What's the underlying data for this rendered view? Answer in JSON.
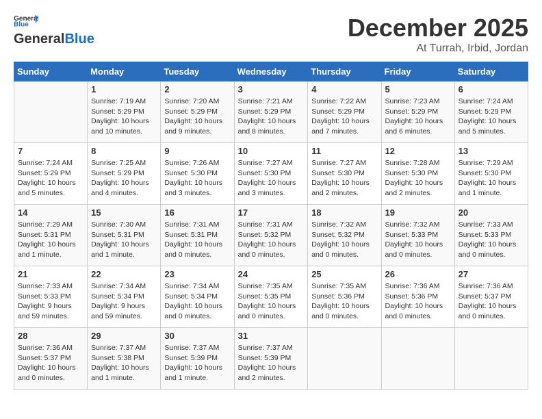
{
  "header": {
    "logo_general": "General",
    "logo_blue": "Blue",
    "month": "December 2025",
    "location": "At Turrah, Irbid, Jordan"
  },
  "weekdays": [
    "Sunday",
    "Monday",
    "Tuesday",
    "Wednesday",
    "Thursday",
    "Friday",
    "Saturday"
  ],
  "weeks": [
    [
      {
        "day": "",
        "info": ""
      },
      {
        "day": "1",
        "info": "Sunrise: 7:19 AM\nSunset: 5:29 PM\nDaylight: 10 hours\nand 10 minutes."
      },
      {
        "day": "2",
        "info": "Sunrise: 7:20 AM\nSunset: 5:29 PM\nDaylight: 10 hours\nand 9 minutes."
      },
      {
        "day": "3",
        "info": "Sunrise: 7:21 AM\nSunset: 5:29 PM\nDaylight: 10 hours\nand 8 minutes."
      },
      {
        "day": "4",
        "info": "Sunrise: 7:22 AM\nSunset: 5:29 PM\nDaylight: 10 hours\nand 7 minutes."
      },
      {
        "day": "5",
        "info": "Sunrise: 7:23 AM\nSunset: 5:29 PM\nDaylight: 10 hours\nand 6 minutes."
      },
      {
        "day": "6",
        "info": "Sunrise: 7:24 AM\nSunset: 5:29 PM\nDaylight: 10 hours\nand 5 minutes."
      }
    ],
    [
      {
        "day": "7",
        "info": "Sunrise: 7:24 AM\nSunset: 5:29 PM\nDaylight: 10 hours\nand 5 minutes."
      },
      {
        "day": "8",
        "info": "Sunrise: 7:25 AM\nSunset: 5:29 PM\nDaylight: 10 hours\nand 4 minutes."
      },
      {
        "day": "9",
        "info": "Sunrise: 7:26 AM\nSunset: 5:30 PM\nDaylight: 10 hours\nand 3 minutes."
      },
      {
        "day": "10",
        "info": "Sunrise: 7:27 AM\nSunset: 5:30 PM\nDaylight: 10 hours\nand 3 minutes."
      },
      {
        "day": "11",
        "info": "Sunrise: 7:27 AM\nSunset: 5:30 PM\nDaylight: 10 hours\nand 2 minutes."
      },
      {
        "day": "12",
        "info": "Sunrise: 7:28 AM\nSunset: 5:30 PM\nDaylight: 10 hours\nand 2 minutes."
      },
      {
        "day": "13",
        "info": "Sunrise: 7:29 AM\nSunset: 5:30 PM\nDaylight: 10 hours\nand 1 minute."
      }
    ],
    [
      {
        "day": "14",
        "info": "Sunrise: 7:29 AM\nSunset: 5:31 PM\nDaylight: 10 hours\nand 1 minute."
      },
      {
        "day": "15",
        "info": "Sunrise: 7:30 AM\nSunset: 5:31 PM\nDaylight: 10 hours\nand 1 minute."
      },
      {
        "day": "16",
        "info": "Sunrise: 7:31 AM\nSunset: 5:31 PM\nDaylight: 10 hours\nand 0 minutes."
      },
      {
        "day": "17",
        "info": "Sunrise: 7:31 AM\nSunset: 5:32 PM\nDaylight: 10 hours\nand 0 minutes."
      },
      {
        "day": "18",
        "info": "Sunrise: 7:32 AM\nSunset: 5:32 PM\nDaylight: 10 hours\nand 0 minutes."
      },
      {
        "day": "19",
        "info": "Sunrise: 7:32 AM\nSunset: 5:33 PM\nDaylight: 10 hours\nand 0 minutes."
      },
      {
        "day": "20",
        "info": "Sunrise: 7:33 AM\nSunset: 5:33 PM\nDaylight: 10 hours\nand 0 minutes."
      }
    ],
    [
      {
        "day": "21",
        "info": "Sunrise: 7:33 AM\nSunset: 5:33 PM\nDaylight: 9 hours\nand 59 minutes."
      },
      {
        "day": "22",
        "info": "Sunrise: 7:34 AM\nSunset: 5:34 PM\nDaylight: 9 hours\nand 59 minutes."
      },
      {
        "day": "23",
        "info": "Sunrise: 7:34 AM\nSunset: 5:34 PM\nDaylight: 10 hours\nand 0 minutes."
      },
      {
        "day": "24",
        "info": "Sunrise: 7:35 AM\nSunset: 5:35 PM\nDaylight: 10 hours\nand 0 minutes."
      },
      {
        "day": "25",
        "info": "Sunrise: 7:35 AM\nSunset: 5:36 PM\nDaylight: 10 hours\nand 0 minutes."
      },
      {
        "day": "26",
        "info": "Sunrise: 7:36 AM\nSunset: 5:36 PM\nDaylight: 10 hours\nand 0 minutes."
      },
      {
        "day": "27",
        "info": "Sunrise: 7:36 AM\nSunset: 5:37 PM\nDaylight: 10 hours\nand 0 minutes."
      }
    ],
    [
      {
        "day": "28",
        "info": "Sunrise: 7:36 AM\nSunset: 5:37 PM\nDaylight: 10 hours\nand 0 minutes."
      },
      {
        "day": "29",
        "info": "Sunrise: 7:37 AM\nSunset: 5:38 PM\nDaylight: 10 hours\nand 1 minute."
      },
      {
        "day": "30",
        "info": "Sunrise: 7:37 AM\nSunset: 5:39 PM\nDaylight: 10 hours\nand 1 minute."
      },
      {
        "day": "31",
        "info": "Sunrise: 7:37 AM\nSunset: 5:39 PM\nDaylight: 10 hours\nand 2 minutes."
      },
      {
        "day": "",
        "info": ""
      },
      {
        "day": "",
        "info": ""
      },
      {
        "day": "",
        "info": ""
      }
    ]
  ]
}
